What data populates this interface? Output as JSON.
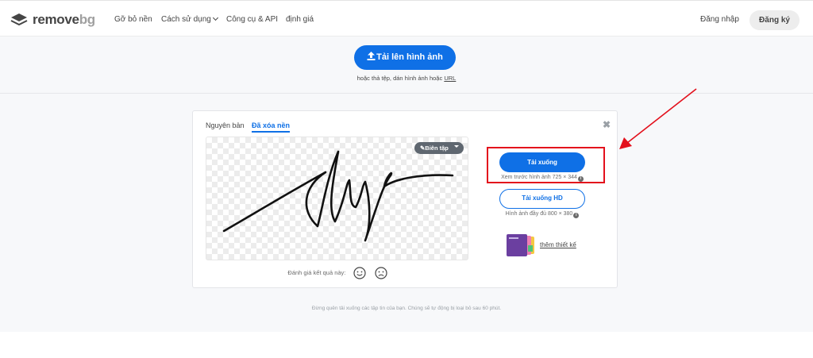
{
  "header": {
    "logo_text": "remove",
    "logo_text_suffix": "bg",
    "nav": [
      {
        "label": "Gỡ bỏ nền"
      },
      {
        "label": "Cách sử dụng"
      },
      {
        "label": "Công cụ & API"
      },
      {
        "label": "định giá"
      }
    ],
    "login_label": "Đăng nhập",
    "signup_label": "Đăng ký"
  },
  "upload": {
    "button_label": "Tải lên hình ảnh",
    "hint_prefix": "hoặc thả tệp, dán hình ảnh hoặc",
    "hint_link": "URL"
  },
  "result": {
    "tabs": [
      {
        "label": "Nguyên bản"
      },
      {
        "label": "Đã xóa nền"
      }
    ],
    "edit_label": "Biên tập",
    "rating_label": "Đánh giá kết quả này:",
    "download_label": "Tải xuống",
    "download_sub": "Xem trước hình ảnh 725 × 344",
    "download_hd_label": "Tải xuống HD",
    "download_hd_sub": "Hình ảnh đầy đủ 800 × 380",
    "design_label": "thêm thiết kế"
  },
  "footnote": "Đừng quên tải xuống các tập tin của bạn. Chúng sẽ tự động bị loại bỏ sau 60 phút.",
  "colors": {
    "accent": "#0f70e6",
    "annotation": "#e3101c"
  }
}
